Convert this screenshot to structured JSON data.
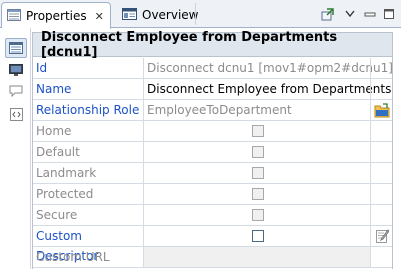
{
  "tabs": [
    {
      "label": "Properties",
      "close": "✕",
      "active": true
    },
    {
      "label": "Overview",
      "active": false
    }
  ],
  "toolbar": {
    "icons": [
      "pin-icon",
      "view-menu-icon",
      "minimize-icon",
      "maximize-icon"
    ]
  },
  "side_toolbar": {
    "icons": [
      "properties-view-icon",
      "monitor-icon",
      "comment-icon",
      "code-icon"
    ]
  },
  "header": {
    "title": "Disconnect Employee from Departments [dcnu1]"
  },
  "rows": [
    {
      "label": "Id",
      "style": "link",
      "value": "Disconnect dcnu1  [mov1#opm2#dcnu1]",
      "value_style": "grey",
      "kind": "text"
    },
    {
      "label": "Name",
      "style": "link",
      "value": "Disconnect Employee from Departments",
      "value_style": "black",
      "kind": "text"
    },
    {
      "label": "Relationship Role",
      "style": "link",
      "value": "EmployeeToDepartment",
      "value_style": "grey",
      "kind": "text",
      "tail": "role-browse-icon"
    },
    {
      "label": "Home",
      "style": "dim",
      "kind": "check",
      "checked": false,
      "enabled": false
    },
    {
      "label": "Default",
      "style": "dim",
      "kind": "check",
      "checked": false,
      "enabled": false
    },
    {
      "label": "Landmark",
      "style": "dim",
      "kind": "check",
      "checked": false,
      "enabled": false
    },
    {
      "label": "Protected",
      "style": "dim",
      "kind": "check",
      "checked": false,
      "enabled": false
    },
    {
      "label": "Secure",
      "style": "dim",
      "kind": "check",
      "checked": false,
      "enabled": false
    },
    {
      "label": "Custom Descriptor",
      "style": "link",
      "kind": "check",
      "checked": false,
      "enabled": true,
      "tail": "edit-descriptor-icon"
    },
    {
      "label": "Custom URL Name",
      "style": "dim",
      "kind": "disabled"
    }
  ],
  "colors": {
    "link": "#1b52c7",
    "dim": "#8c8c8c",
    "header_bg": "#dfe6ee",
    "tab_bg": "#eef2f7"
  }
}
